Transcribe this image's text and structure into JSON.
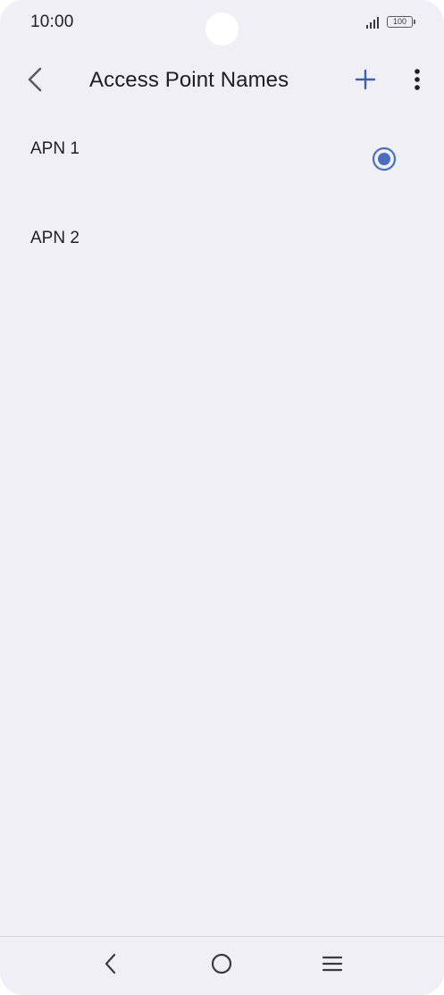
{
  "status_bar": {
    "time": "10:00",
    "battery_level": "100",
    "signal_icon": "signal-icon",
    "battery_icon": "battery-icon"
  },
  "app_bar": {
    "title": "Access Point Names",
    "back_icon": "chevron-left-icon",
    "add_icon": "plus-icon",
    "more_icon": "more-vertical-icon"
  },
  "apn_list": {
    "items": [
      {
        "label": "APN 1",
        "selected": true
      },
      {
        "label": "APN 2",
        "selected": false
      }
    ]
  },
  "nav_bar": {
    "back_icon": "nav-back-icon",
    "home_icon": "nav-home-icon",
    "recents_icon": "nav-recents-icon"
  },
  "colors": {
    "background": "#f0eff6",
    "accent": "#4a6fbf",
    "text": "#1f1f24"
  }
}
